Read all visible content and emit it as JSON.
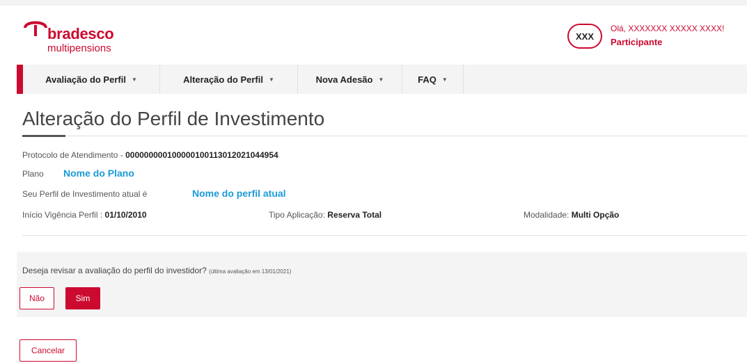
{
  "header": {
    "brand": "bradesco",
    "brand_sub": "multipensions",
    "avatar_initials": "XXX",
    "greeting": "Olá, XXXXXXX XXXXX XXXX!",
    "role": "Participante"
  },
  "nav": {
    "items": [
      {
        "label": "Avaliação do Perfil"
      },
      {
        "label": "Alteração do Perfil"
      },
      {
        "label": "Nova Adesão"
      },
      {
        "label": "FAQ"
      }
    ]
  },
  "page": {
    "title": "Alteração do Perfil de Investimento"
  },
  "details": {
    "protocolo_label": "Protocolo de Atendimento - ",
    "protocolo_value": "000000000100000100113012021044954",
    "plano_label": "Plano",
    "plano_value": "Nome do Plano",
    "perfil_label": "Seu Perfil de Investimento atual é",
    "perfil_value": "Nome do perfil atual",
    "inicio_label": "Início Vigência Perfil : ",
    "inicio_value": "01/10/2010",
    "tipo_label": "Tipo Aplicação: ",
    "tipo_value": "Reserva Total",
    "modalidade_label": "Modalidade: ",
    "modalidade_value": "Multi Opção"
  },
  "question": {
    "text": "Deseja revisar a avaliação do perfil do investidor?",
    "note": "(última avaliação em 13/01/2021)",
    "no_label": "Não",
    "yes_label": "Sim"
  },
  "actions": {
    "cancel_label": "Cancelar"
  },
  "colors": {
    "brand_red": "#cc092f",
    "highlight_blue": "#1a9bd7"
  }
}
